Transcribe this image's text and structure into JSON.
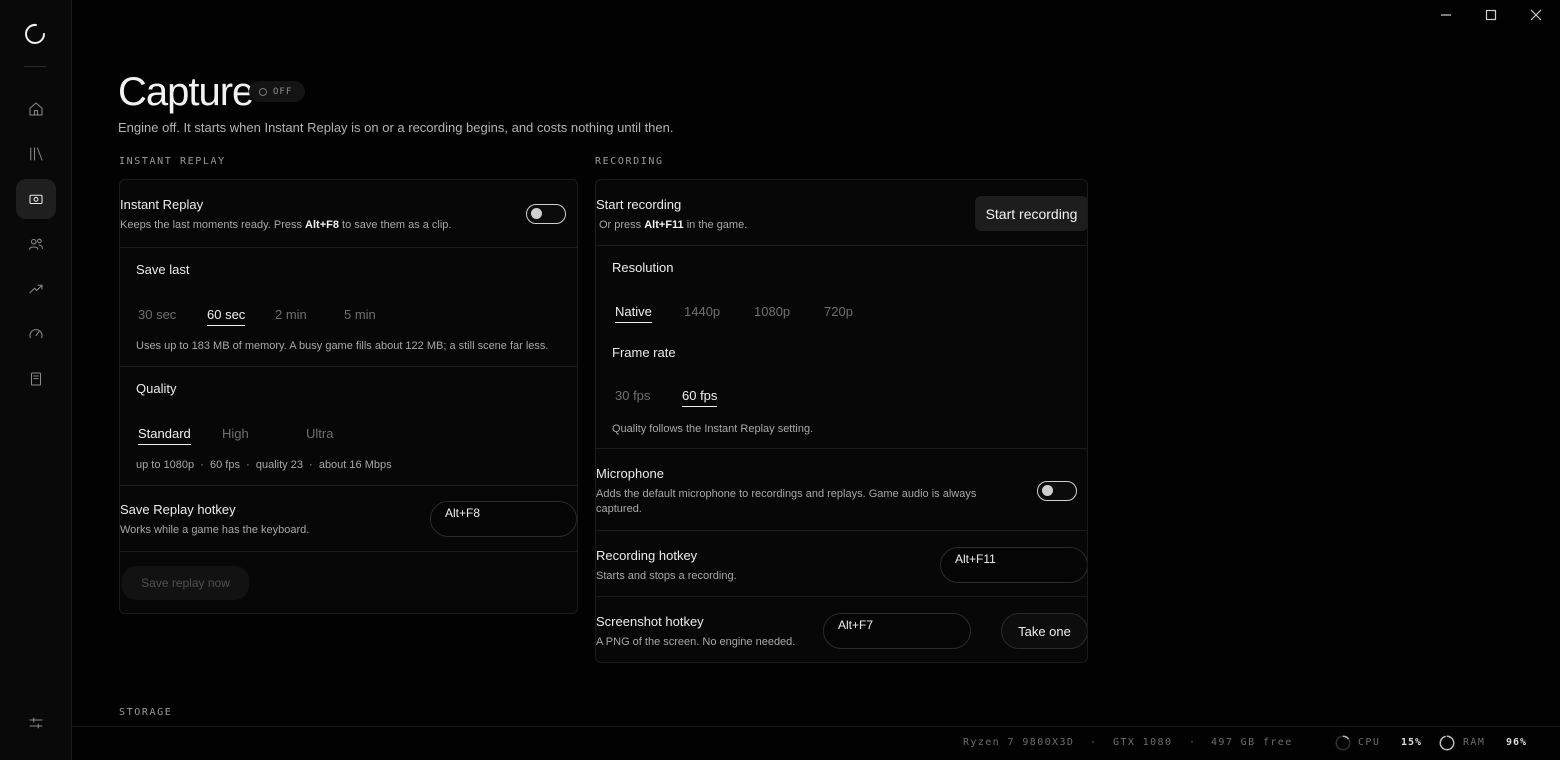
{
  "window": {
    "minimize_icon": "minimize-icon",
    "maximize_icon": "maximize-icon",
    "close_icon": "close-icon"
  },
  "sidebar": {
    "logo_icon": "app-logo-icon",
    "items": [
      {
        "id": "home",
        "icon": "home-icon",
        "active": false
      },
      {
        "id": "library",
        "icon": "library-icon",
        "active": false
      },
      {
        "id": "capture",
        "icon": "camera-icon",
        "active": true
      },
      {
        "id": "friends",
        "icon": "users-icon",
        "active": false
      },
      {
        "id": "stats",
        "icon": "trend-icon",
        "active": false
      },
      {
        "id": "performance",
        "icon": "gauge-icon",
        "active": false
      },
      {
        "id": "notes",
        "icon": "document-icon",
        "active": false
      }
    ],
    "settings_icon": "sliders-icon"
  },
  "header": {
    "title": "Capture",
    "status": "OFF",
    "subtitle": "Engine off. It starts when Instant Replay is on or a recording begins, and costs nothing until then."
  },
  "instant_replay": {
    "section_label": "INSTANT REPLAY",
    "toggle": {
      "title": "Instant Replay",
      "desc_pre": "Keeps the last moments ready. Press ",
      "desc_key": "Alt+F8",
      "desc_post": " to save them as a clip.",
      "on": false
    },
    "save_last": {
      "title": "Save last",
      "options": [
        "30 sec",
        "60 sec",
        "2 min",
        "5 min"
      ],
      "selected": "60 sec",
      "note": "Uses up to 183 MB of memory. A busy game fills about 122 MB; a still scene far less."
    },
    "quality": {
      "title": "Quality",
      "options": [
        "Standard",
        "High",
        "Ultra"
      ],
      "selected": "Standard",
      "note": "up to 1080p  ·  60 fps  ·  quality 23  ·  about 16 Mbps"
    },
    "hotkey": {
      "title": "Save Replay hotkey",
      "desc": "Works while a game has the keyboard.",
      "value": "Alt+F8"
    },
    "save_now": "Save replay now"
  },
  "recording": {
    "section_label": "RECORDING",
    "start": {
      "title": "Start recording",
      "desc_pre": "Or press ",
      "desc_key": "Alt+F11",
      "desc_post": " in the game.",
      "button": "Start recording"
    },
    "resolution": {
      "title": "Resolution",
      "options": [
        "Native",
        "1440p",
        "1080p",
        "720p"
      ],
      "selected": "Native"
    },
    "frame_rate": {
      "title": "Frame rate",
      "options": [
        "30 fps",
        "60 fps"
      ],
      "selected": "60 fps",
      "note": "Quality follows the Instant Replay setting."
    },
    "microphone": {
      "title": "Microphone",
      "desc": "Adds the default microphone to recordings and replays. Game audio is always captured.",
      "on": false
    },
    "hotkey": {
      "title": "Recording hotkey",
      "desc": "Starts and stops a recording.",
      "value": "Alt+F11"
    },
    "screenshot": {
      "title": "Screenshot hotkey",
      "desc": "A PNG of the screen. No engine needed.",
      "value": "Alt+F7",
      "button": "Take one"
    }
  },
  "storage": {
    "section_label": "STORAGE"
  },
  "footer": {
    "cpu_model": "Ryzen 7 9800X3D",
    "gpu_model": "GTX 1080",
    "disk": "497 GB free",
    "sep": "·",
    "cpu_label": "CPU",
    "cpu_value": "15%",
    "cpu_fraction": 0.15,
    "ram_label": "RAM",
    "ram_value": "96%",
    "ram_fraction": 0.96
  }
}
